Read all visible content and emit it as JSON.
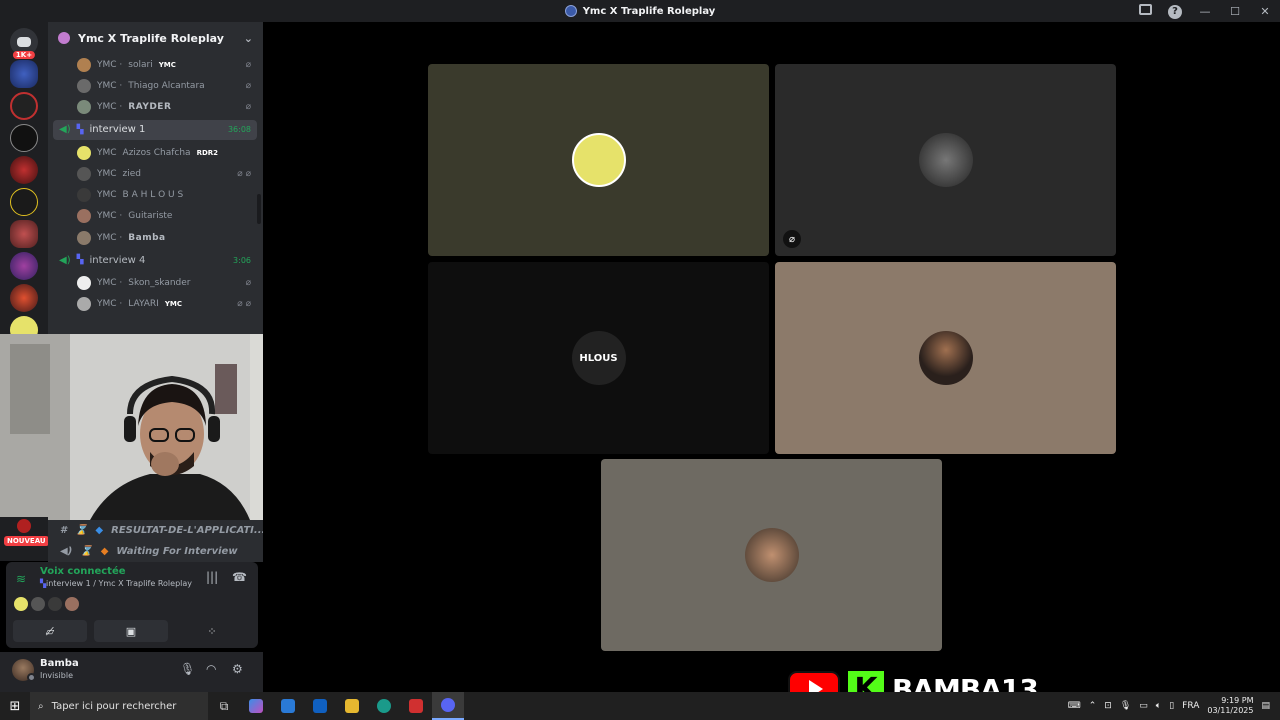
{
  "window": {
    "title": "Ymc X Traplife Roleplay",
    "controls": {
      "inbox": "inbox-icon",
      "help": "?",
      "minimize": "—",
      "maximize": "☐",
      "close": "✕"
    }
  },
  "guilds": {
    "badge_top": "1K+",
    "new_badge": "NOUVEAU"
  },
  "server": {
    "name": "Ymc X Traplife Roleplay",
    "chevron": "⌄"
  },
  "voice": {
    "prev_users": [
      {
        "prefix": "YMC ·",
        "name": "solari",
        "tag": "YMC",
        "color": "#b08050"
      },
      {
        "prefix": "YMC ·",
        "name": "Thiago Alcantara",
        "tag": "",
        "color": "#6a6a6a"
      },
      {
        "prefix": "YMC ·",
        "name": "RAYDER",
        "tag": "",
        "color": "#7a8a7a"
      }
    ],
    "channels": [
      {
        "name": "interview 1",
        "time": "36:08",
        "users": [
          {
            "prefix": "YMC",
            "name": "Azizos Chafcha",
            "tag": "RDR2",
            "color": "#e6e26a"
          },
          {
            "prefix": "YMC",
            "name": "zied",
            "tag": "",
            "color": "#555"
          },
          {
            "prefix": "YMC",
            "name": "B A H L O U S",
            "tag": "",
            "color": "#3a3a3a"
          },
          {
            "prefix": "YMC ·",
            "name": "Guitariste",
            "tag": "",
            "color": "#9a7060"
          },
          {
            "prefix": "YMC ·",
            "name": "Bamba",
            "tag": "",
            "color": "#8a7a6a"
          }
        ]
      },
      {
        "name": "interview 4",
        "time": "3:06",
        "users": [
          {
            "prefix": "YMC ·",
            "name": "Skon_skander",
            "tag": "",
            "color": "#eeeeee"
          },
          {
            "prefix": "YMC ·",
            "name": "LAYARI",
            "tag": "YMC",
            "color": "#aaaaaa"
          }
        ]
      }
    ]
  },
  "text_channels": [
    {
      "name": "RESULTAT-DE-L'APPLICATI..."
    },
    {
      "name": "Waiting For Interview"
    }
  ],
  "voice_panel": {
    "status": "Voix connectée",
    "location": "interview 1 / Ymc X Traplife Roleplay"
  },
  "user": {
    "name": "Bamba",
    "status": "Invisible"
  },
  "tiles": [
    {
      "bg": "#3a3a2c",
      "avatar": "#e6e26a",
      "muted": false
    },
    {
      "bg": "#2a2a2a",
      "avatar": "#444444",
      "muted": true
    },
    {
      "bg": "#0e0e0e",
      "avatar": "#222222",
      "muted": false,
      "label": "HLOUS"
    },
    {
      "bg": "#8c7a6a",
      "avatar": "#3a2e2a",
      "muted": false
    },
    {
      "bg": "#6e6a62",
      "avatar": "#a08060",
      "muted": false
    }
  ],
  "overlay": {
    "channel_name": "BAMBA13",
    "kick_letter": "K"
  },
  "taskbar": {
    "search_placeholder": "Taper ici pour rechercher",
    "language": "FRA",
    "time": "9:19 PM",
    "date": "03/11/2025"
  }
}
